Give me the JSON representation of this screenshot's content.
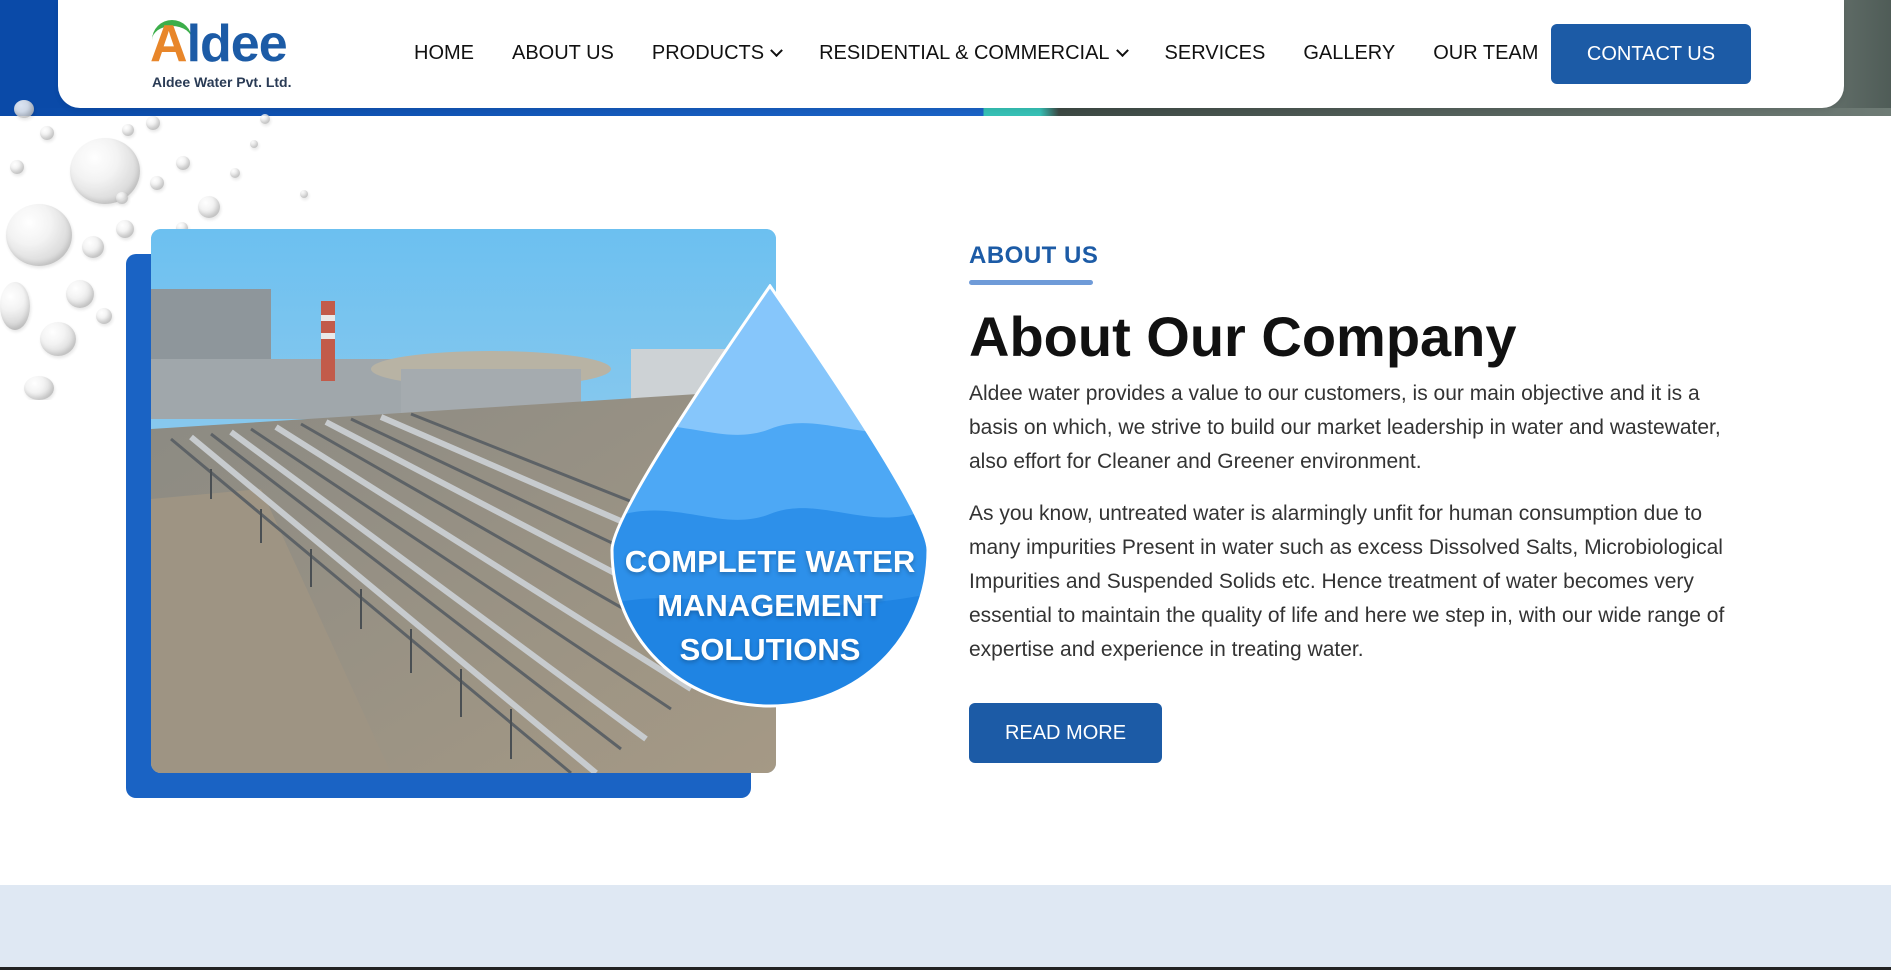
{
  "header": {
    "logo_text_a": "A",
    "logo_text_rest": "ldee",
    "logo_subtitle": "Aldee Water Pvt. Ltd.",
    "nav": [
      {
        "label": "HOME",
        "has_dropdown": false
      },
      {
        "label": "ABOUT US",
        "has_dropdown": false
      },
      {
        "label": "PRODUCTS",
        "has_dropdown": true
      },
      {
        "label": "RESIDENTIAL & COMMERCIAL",
        "has_dropdown": true
      },
      {
        "label": "SERVICES",
        "has_dropdown": false
      },
      {
        "label": "GALLERY",
        "has_dropdown": false
      },
      {
        "label": "OUR TEAM",
        "has_dropdown": false
      }
    ],
    "contact_label": "CONTACT US"
  },
  "about": {
    "eyebrow": "ABOUT US",
    "title": "About Our Company",
    "paragraph1": "Aldee water provides a value to our customers, is our main objective and it is a basis on which, we strive to build our market leadership in water and wastewater, also effort for Cleaner and Greener environment.",
    "paragraph2": "As you know, untreated water is alarmingly unfit for human consumption due to many impurities Present in water such as excess Dissolved Salts, Microbiological Impurities and Suspended Solids etc. Hence treatment of water becomes very essential to maintain the quality of life and here we step in, with our wide range of expertise and experience in treating water.",
    "read_more_label": "READ MORE"
  },
  "image_badge": {
    "line1": "COMPLETE WATER",
    "line2": "MANAGEMENT",
    "line3": "SOLUTIONS"
  },
  "colors": {
    "brand_blue": "#1c5ba6",
    "accent_blue": "#1a63c4",
    "logo_orange": "#e8862a",
    "logo_green": "#3cae4a",
    "band": "#dfe8f3"
  },
  "icons": {
    "dropdown": "chevron-down-icon"
  }
}
